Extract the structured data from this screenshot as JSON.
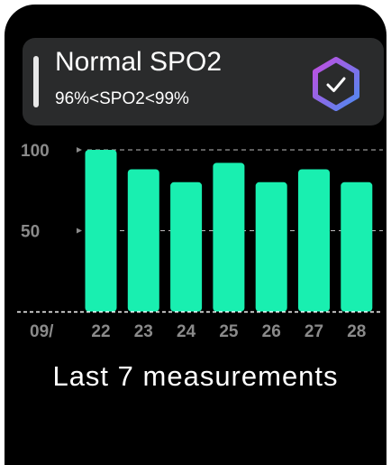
{
  "status": {
    "title": "Normal SPO2",
    "range": "96%<SPO2<99%",
    "icon": "hexagon-check-icon"
  },
  "chart_data": {
    "type": "bar",
    "x_prefix": "09/",
    "categories": [
      "22",
      "23",
      "24",
      "25",
      "26",
      "27",
      "28"
    ],
    "values": [
      100,
      88,
      80,
      92,
      80,
      88,
      80
    ],
    "y_ticks": [
      "100",
      "50"
    ],
    "ylim": [
      0,
      100
    ],
    "grid": true,
    "title": "",
    "xlabel": "",
    "ylabel": ""
  },
  "caption": "Last 7 measurements",
  "colors": {
    "bar": "#19efb0",
    "card": "#2a2b2c",
    "tick": "#8a8a8a",
    "hex_gradient": [
      "#c24de0",
      "#4d8af0"
    ]
  }
}
